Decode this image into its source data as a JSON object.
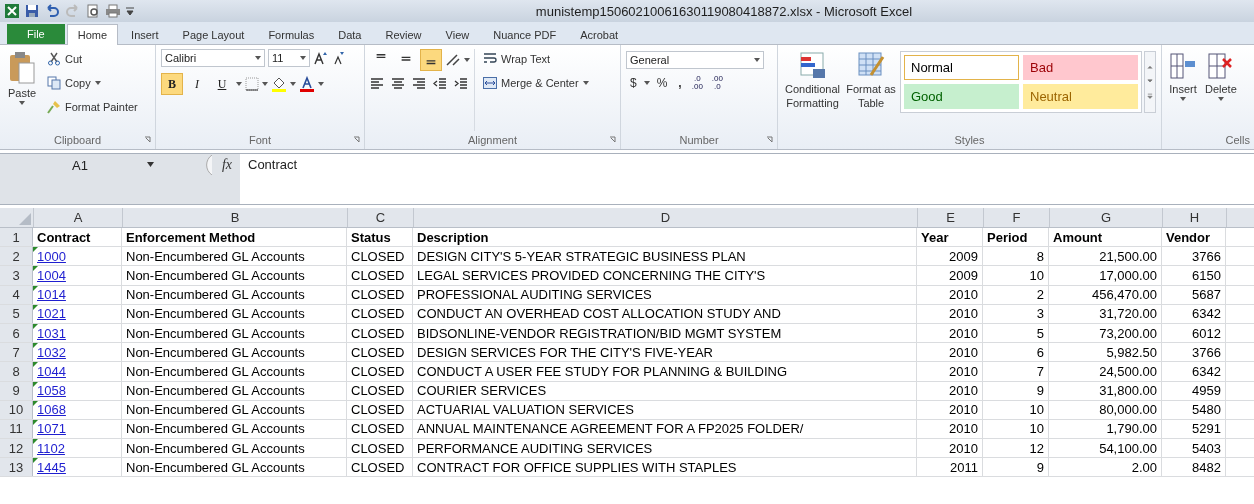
{
  "window": {
    "title": "munistemp15060210061630119080418872.xlsx  -  Microsoft Excel"
  },
  "file_tab": {
    "label": "File"
  },
  "tabs": [
    {
      "label": "Home",
      "selected": true
    },
    {
      "label": "Insert",
      "selected": false
    },
    {
      "label": "Page Layout",
      "selected": false
    },
    {
      "label": "Formulas",
      "selected": false
    },
    {
      "label": "Data",
      "selected": false
    },
    {
      "label": "Review",
      "selected": false
    },
    {
      "label": "View",
      "selected": false
    },
    {
      "label": "Nuance PDF",
      "selected": false
    },
    {
      "label": "Acrobat",
      "selected": false
    }
  ],
  "ribbon": {
    "clipboard": {
      "label": "Clipboard",
      "paste": "Paste",
      "cut": "Cut",
      "copy": "Copy",
      "format_painter": "Format Painter"
    },
    "font": {
      "label": "Font",
      "font_name": "Calibri",
      "font_size": "11",
      "toggles": [
        {
          "kind": "bold",
          "label": "B",
          "on": true
        },
        {
          "kind": "italic",
          "label": "I",
          "on": false
        },
        {
          "kind": "underline",
          "label": "U",
          "on": false
        }
      ]
    },
    "alignment": {
      "label": "Alignment",
      "vertical": [
        {
          "kind": "top",
          "on": false
        },
        {
          "kind": "middle",
          "on": false
        },
        {
          "kind": "bottom",
          "on": true
        }
      ],
      "wrap_text": "Wrap Text",
      "merge_center": "Merge & Center"
    },
    "number": {
      "label": "Number",
      "format": "General",
      "currency": "$",
      "percent": "%",
      "comma": ",",
      "increase_decimal": [
        ".0",
        ".00"
      ],
      "decrease_decimal": [
        ".00",
        ".0"
      ]
    },
    "styles": {
      "label": "Styles",
      "conditional_formatting": [
        "Conditional",
        "Formatting"
      ],
      "format_as_table": [
        "Format as",
        "Table"
      ],
      "cell_styles": [
        {
          "label": "Normal",
          "kind": "normal",
          "color": "#ffffff",
          "selected": true
        },
        {
          "label": "Bad",
          "kind": "bad",
          "color": "#ffc7ce",
          "selected": false
        },
        {
          "label": "Good",
          "kind": "good",
          "color": "#c6efce",
          "selected": false
        },
        {
          "label": "Neutral",
          "kind": "neutral",
          "color": "#ffeb9c",
          "selected": false
        }
      ]
    },
    "cells": {
      "label": "Cells",
      "insert": "Insert",
      "delete": "Delete"
    }
  },
  "formula_bar": {
    "name_box": "A1",
    "function_symbol": "fx",
    "formula": "Contract"
  },
  "sheet": {
    "columns": [
      {
        "letter": "A",
        "kind": "link"
      },
      {
        "letter": "B",
        "kind": "text"
      },
      {
        "letter": "C",
        "kind": "text"
      },
      {
        "letter": "D",
        "kind": "text"
      },
      {
        "letter": "E",
        "kind": "number"
      },
      {
        "letter": "F",
        "kind": "number"
      },
      {
        "letter": "G",
        "kind": "number"
      },
      {
        "letter": "H",
        "kind": "number"
      }
    ],
    "header_row": {
      "number": "1",
      "cells": [
        "Contract",
        "Enforcement Method",
        "Status",
        "Description",
        "Year",
        "Period",
        "Amount",
        "Vendor"
      ]
    },
    "rows": [
      {
        "number": "2",
        "cells": [
          "1000",
          "Non-Encumbered GL Accounts",
          "CLOSED",
          "DESIGN CITY'S 5-YEAR STRATEGIC BUSINESS PLAN",
          "2009",
          "8",
          "21,500.00",
          "3766"
        ]
      },
      {
        "number": "3",
        "cells": [
          "1004",
          "Non-Encumbered GL Accounts",
          "CLOSED",
          "LEGAL SERVICES PROVIDED CONCERNING THE CITY'S",
          "2009",
          "10",
          "17,000.00",
          "6150"
        ]
      },
      {
        "number": "4",
        "cells": [
          "1014",
          "Non-Encumbered GL Accounts",
          "CLOSED",
          "PROFESSIONAL AUDITING SERVICES",
          "2010",
          "2",
          "456,470.00",
          "5687"
        ]
      },
      {
        "number": "5",
        "cells": [
          "1021",
          "Non-Encumbered GL Accounts",
          "CLOSED",
          "CONDUCT AN OVERHEAD COST ALLOCATION STUDY AND",
          "2010",
          "3",
          "31,720.00",
          "6342"
        ]
      },
      {
        "number": "6",
        "cells": [
          "1031",
          "Non-Encumbered GL Accounts",
          "CLOSED",
          "BIDSONLINE-VENDOR REGISTRATION/BID MGMT SYSTEM",
          "2010",
          "5",
          "73,200.00",
          "6012"
        ]
      },
      {
        "number": "7",
        "cells": [
          "1032",
          "Non-Encumbered GL Accounts",
          "CLOSED",
          "DESIGN SERVICES FOR THE CITY'S FIVE-YEAR",
          "2010",
          "6",
          "5,982.50",
          "3766"
        ]
      },
      {
        "number": "8",
        "cells": [
          "1044",
          "Non-Encumbered GL Accounts",
          "CLOSED",
          "CONDUCT A USER FEE STUDY FOR PLANNING & BUILDING",
          "2010",
          "7",
          "24,500.00",
          "6342"
        ]
      },
      {
        "number": "9",
        "cells": [
          "1058",
          "Non-Encumbered GL Accounts",
          "CLOSED",
          "COURIER SERVICES",
          "2010",
          "9",
          "31,800.00",
          "4959"
        ]
      },
      {
        "number": "10",
        "cells": [
          "1068",
          "Non-Encumbered GL Accounts",
          "CLOSED",
          "ACTUARIAL VALUATION SERVICES",
          "2010",
          "10",
          "80,000.00",
          "5480"
        ]
      },
      {
        "number": "11",
        "cells": [
          "1071",
          "Non-Encumbered GL Accounts",
          "CLOSED",
          "ANNUAL MAINTENANCE AGREEMENT FOR A FP2025 FOLDER/",
          "2010",
          "10",
          "1,790.00",
          "5291"
        ]
      },
      {
        "number": "12",
        "cells": [
          "1102",
          "Non-Encumbered GL Accounts",
          "CLOSED",
          "PERFORMANCE AUDITING SERVICES",
          "2010",
          "12",
          "54,100.00",
          "5403"
        ]
      },
      {
        "number": "13",
        "cells": [
          "1445",
          "Non-Encumbered GL Accounts",
          "CLOSED",
          "CONTRACT FOR OFFICE SUPPLIES WITH STAPLES",
          "2011",
          "9",
          "2.00",
          "8482"
        ]
      }
    ]
  }
}
